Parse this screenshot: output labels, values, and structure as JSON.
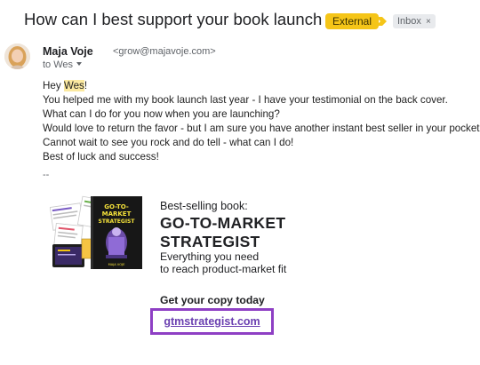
{
  "email": {
    "subject": "How can I best support your book launch",
    "labels": {
      "external": "External",
      "inbox": "Inbox",
      "inbox_close": "×"
    },
    "sender": {
      "name": "Maja Voje",
      "email": "<grow@majavoje.com>"
    },
    "to_line": "to Wes",
    "body": {
      "greeting_prefix": "Hey ",
      "greeting_name": "Wes",
      "greeting_suffix": "!",
      "lines": [
        "You helped me with my book launch last year - I have your testimonial on the back cover.",
        "What can I do for you now when you are launching?",
        "Would love to return the favor - but I am sure you have another instant best seller in your pocket!",
        "Cannot wait to see you rock and do tell - what can I do!",
        "Best of luck and success!"
      ]
    },
    "signature": {
      "separator": "--",
      "label": "Best-selling book:",
      "title_line1": "GO-TO-MARKET",
      "title_line2": "STRATEGIST",
      "subtitle_line1": "Everything you need",
      "subtitle_line2": "to reach product-market fit",
      "cta_label": "Get your copy today",
      "link_text": "gtmstrategist.com",
      "book_cover": {
        "line1": "GO-TO-",
        "line2": "MARKET",
        "line3": "STRATEGIST",
        "author": "MAJA VOJE"
      }
    }
  },
  "colors": {
    "external_badge": "#f5c518",
    "important_marker": "#f5c518",
    "link_border": "#8e3fc4",
    "link_text": "#6a3fb0",
    "highlight": "#fbe9a0"
  },
  "icons": {
    "important_marker": "importance-arrow-icon",
    "to_dropdown": "chevron-down-icon"
  }
}
